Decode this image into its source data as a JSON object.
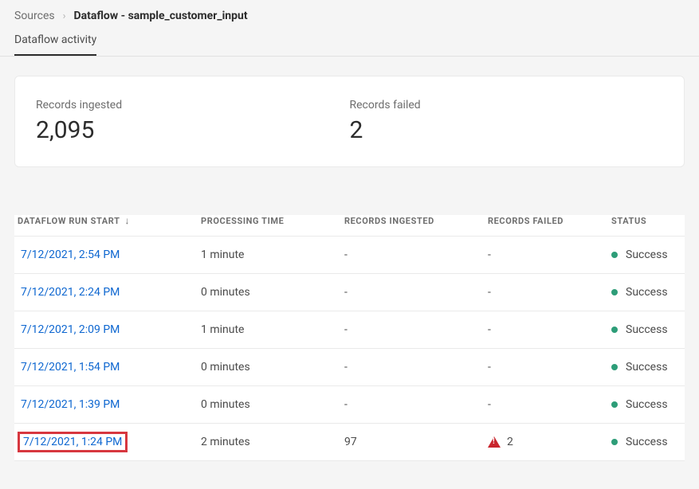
{
  "breadcrumb": {
    "root": "Sources",
    "current": "Dataflow - sample_customer_input"
  },
  "tabs": {
    "activity": "Dataflow activity"
  },
  "stats": {
    "ingested_label": "Records ingested",
    "ingested_value": "2,095",
    "failed_label": "Records failed",
    "failed_value": "2"
  },
  "table": {
    "headers": {
      "start": "DATAFLOW RUN START",
      "processing": "PROCESSING TIME",
      "ingested": "RECORDS INGESTED",
      "failed": "RECORDS FAILED",
      "status": "STATUS"
    },
    "rows": [
      {
        "start": "7/12/2021, 2:54 PM",
        "processing": "1 minute",
        "ingested": "-",
        "failed": "-",
        "failed_warn": false,
        "status": "Success",
        "highlight": false
      },
      {
        "start": "7/12/2021, 2:24 PM",
        "processing": "0 minutes",
        "ingested": "-",
        "failed": "-",
        "failed_warn": false,
        "status": "Success",
        "highlight": false
      },
      {
        "start": "7/12/2021, 2:09 PM",
        "processing": "1 minute",
        "ingested": "-",
        "failed": "-",
        "failed_warn": false,
        "status": "Success",
        "highlight": false
      },
      {
        "start": "7/12/2021, 1:54 PM",
        "processing": "0 minutes",
        "ingested": "-",
        "failed": "-",
        "failed_warn": false,
        "status": "Success",
        "highlight": false
      },
      {
        "start": "7/12/2021, 1:39 PM",
        "processing": "0 minutes",
        "ingested": "-",
        "failed": "-",
        "failed_warn": false,
        "status": "Success",
        "highlight": false
      },
      {
        "start": "7/12/2021, 1:24 PM",
        "processing": "2 minutes",
        "ingested": "97",
        "failed": "2",
        "failed_warn": true,
        "status": "Success",
        "highlight": true
      }
    ]
  }
}
